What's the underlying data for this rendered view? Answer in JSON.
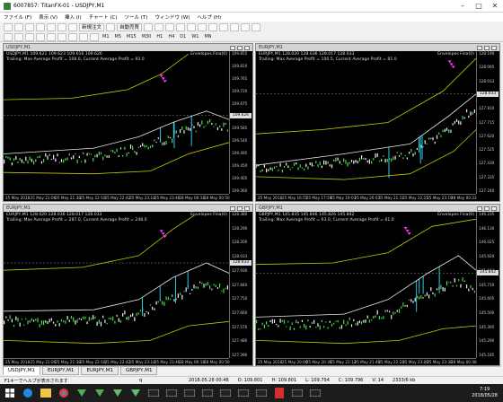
{
  "window": {
    "title": "6007857: TitanFX-01 - USDJPY,M1",
    "min": "–",
    "max": "□",
    "close": "✕"
  },
  "menu": [
    "ファイル (F)",
    "表示 (V)",
    "挿入 (I)",
    "チャート (C)",
    "ツール (T)",
    "ウィンドウ (W)",
    "ヘルプ (H)"
  ],
  "toolbar": {
    "new_order": "新規注文",
    "auto_trade": "自動売買",
    "timeframes": [
      "M1",
      "M5",
      "M15",
      "M30",
      "H1",
      "H4",
      "D1",
      "W1",
      "MN"
    ]
  },
  "charts": [
    {
      "title": "USDJPY,M1",
      "header": "USDJPY,M1 109.621 109.623 109.616 109.626",
      "trail": "Trailing: Max Average Profit = 108.0, Current Average Profit = 93.0",
      "indicator": "Envelopes Fina(0)",
      "prices": [
        "109.855",
        "109.810",
        "109.765",
        "109.720",
        "109.675",
        "109.626",
        "109.585",
        "109.540",
        "109.495",
        "109.450",
        "109.405",
        "109.360"
      ],
      "last": "109.626",
      "times": [
        "25 May 2018",
        "25 May 21:06",
        "25 May 21:38",
        "25 May 22:10",
        "25 May 22:42",
        "25 May 23:14",
        "25 May 23:46",
        "28 May 00:18",
        "28 May 00:50"
      ]
    },
    {
      "title": "EURJPY,M1",
      "header": "EURJPY,M1 128.020 128.036 128.017 128.033",
      "trail": "Trailing: Max Average Profit = 100.5, Current Average Profit = 81.0",
      "indicator": "Envelopes Fina(0)",
      "prices": [
        "128.190",
        "128.095",
        "128.033",
        "127.905",
        "127.810",
        "127.715",
        "127.620",
        "127.525",
        "127.430",
        "127.335",
        "127.240"
      ],
      "last": "128.033",
      "times": [
        "25 May 2018",
        "25 May 16:55",
        "25 May 17:59",
        "25 May 19:03",
        "25 May 20:07",
        "25 May 21:11",
        "25 May 22:15",
        "25 May 23:19",
        "28 May 00:23"
      ]
    },
    {
      "title": "EURJPY,M1",
      "header": "EURJPY,M1 128.020 128.036 128.017 128.033",
      "trail": "Trailing: Max Average Profit = 287.0, Current Average Profit = 248.0",
      "indicator": "Envelopes Fina(0)",
      "prices": [
        "128.380",
        "128.290",
        "128.200",
        "128.033",
        "127.930",
        "127.840",
        "127.750",
        "127.660",
        "127.570",
        "127.480",
        "127.390"
      ],
      "last": "128.033",
      "times": [
        "25 May 2018",
        "25 May 21:06",
        "25 May 21:38",
        "25 May 22:10",
        "25 May 22:42",
        "25 May 23:14",
        "25 May 23:46",
        "28 May 00:18",
        "28 May 00:50"
      ]
    },
    {
      "title": "GBPJPY,M1",
      "header": "GBPJPY,M1 145.835 145.846 145.826 145.842",
      "trail": "Trailing: Max Average Profit = 63.0, Current Average Profit = 61.0",
      "indicator": "Envelopes Fina(0)",
      "prices": [
        "146.235",
        "146.130",
        "146.025",
        "145.920",
        "145.842",
        "145.710",
        "145.605",
        "145.500",
        "145.395",
        "145.290",
        "145.185"
      ],
      "last": "145.842",
      "times": [
        "25 May 2018",
        "25 May 20:00",
        "25 May 20:36",
        "25 May 21:12",
        "25 May 21:48",
        "25 May 22:24",
        "25 May 23:00",
        "25 May 23:36",
        "28 May 00:48"
      ]
    }
  ],
  "tabs": [
    "USDJPY,M1",
    "EURJPY,M1",
    "EURJPY,M1",
    "GBPJPY,M1"
  ],
  "status": {
    "help": "F1キーでヘルプが表示されます",
    "profile": "q",
    "time": "2018.05.28 00:48",
    "open": "O: 109.801",
    "high": "H: 109.801",
    "low": "L: 109.794",
    "close": "C: 109.796",
    "vol": "V: 14",
    "kb": "2333/6 kb"
  },
  "clock": {
    "time": "7:19",
    "date": "2018/05/28"
  },
  "colors": {
    "envelope": "#c8c800",
    "ma": "#e8e8e8",
    "bull": "#48d848",
    "bear": "#f0f0f0",
    "marker": "#ff33ff",
    "spike": "#2ec8e8"
  }
}
